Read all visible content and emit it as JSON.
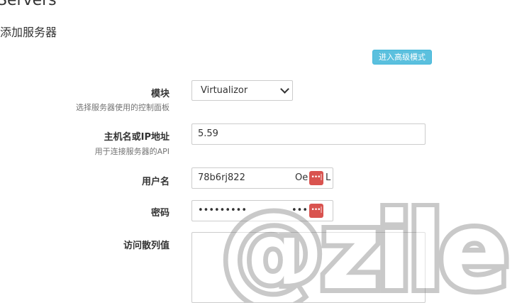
{
  "page_title": "Servers",
  "subtitle": "添加服务器",
  "advanced_mode_button": "进入高级模式",
  "fields": {
    "module": {
      "label": "模块",
      "hint": "选择服务器使用的控制面板",
      "selected": "Virtualizor"
    },
    "hostname": {
      "label": "主机名或IP地址",
      "hint": "用于连接服务器的API",
      "value": "5.59"
    },
    "username": {
      "label": "用户名",
      "value": "78b6rj822",
      "tail": "Oe",
      "tail2": "L"
    },
    "password": {
      "label": "密码",
      "value": "••••••••••••••",
      "tail": "••••••"
    },
    "hash": {
      "label": "访问散列值",
      "value": ""
    }
  },
  "password_icon_glyph": "•••|",
  "watermark": {
    "text": "@zile",
    "color": "#808080"
  }
}
